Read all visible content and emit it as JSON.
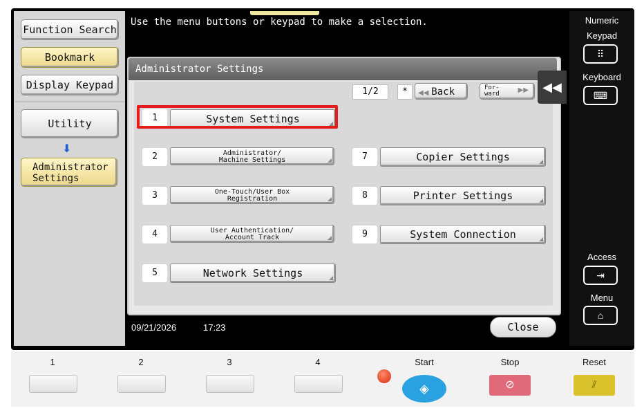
{
  "message": "Use the menu buttons or keypad to make a selection.",
  "left_panel": {
    "function_search": "Function Search",
    "bookmark": "Bookmark",
    "display_keypad": "Display Keypad",
    "utility": "Utility",
    "admin_line1": "Administrator",
    "admin_line2": "Settings",
    "down_arrow": "⬇"
  },
  "dialog": {
    "title": "Administrator Settings",
    "page": "1/2",
    "star": "*",
    "back_label": "Back",
    "back_arrow": "◀◀",
    "forward_line1": "For-",
    "forward_line2": "ward",
    "forward_arrow": "▶▶",
    "items": [
      {
        "num": "1",
        "label1": "System Settings",
        "label2": ""
      },
      {
        "num": "2",
        "label1": "Administrator/",
        "label2": "Machine Settings"
      },
      {
        "num": "3",
        "label1": "One-Touch/User Box",
        "label2": "Registration"
      },
      {
        "num": "4",
        "label1": "User Authentication/",
        "label2": "Account Track"
      },
      {
        "num": "5",
        "label1": "Network Settings",
        "label2": ""
      },
      {
        "num": "7",
        "label1": "Copier Settings",
        "label2": ""
      },
      {
        "num": "8",
        "label1": "Printer Settings",
        "label2": ""
      },
      {
        "num": "9",
        "label1": "System Connection",
        "label2": ""
      }
    ],
    "collapse": "◀◀"
  },
  "status": {
    "date": "09/21/2026",
    "time": "17:23",
    "close": "Close"
  },
  "right_panel": {
    "numeric": "Numeric",
    "keypad": "Keypad",
    "keypad_icon": "⠿",
    "keyboard": "Keyboard",
    "keyboard_icon": "⌨",
    "access": "Access",
    "access_icon": "⇥",
    "menu": "Menu",
    "menu_icon": "⌂"
  },
  "hardware": {
    "keys": [
      "1",
      "2",
      "3",
      "4"
    ],
    "start": "Start",
    "start_icon": "◈",
    "stop": "Stop",
    "stop_icon": "⊘",
    "reset": "Reset",
    "reset_icon": "⫽"
  },
  "colors": {
    "highlight": "#e41c1c",
    "start": "#2aa1e0",
    "stop": "#e06a7a",
    "reset": "#d9c22c",
    "selected_yellow": "#ecd889"
  }
}
